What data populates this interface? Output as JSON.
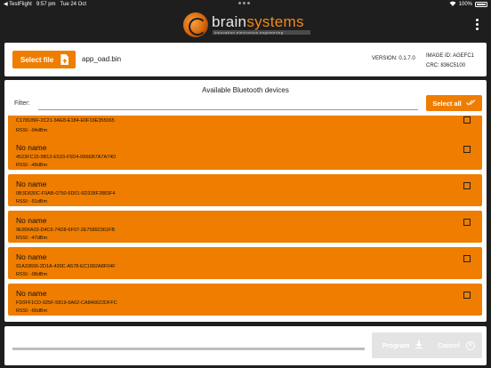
{
  "status_bar": {
    "back_app": "◀ TestFlight",
    "time": "9:57 pm",
    "date": "Tue 24 Oct",
    "battery": "100%"
  },
  "header": {
    "logo_brain": "brain",
    "logo_systems": "systems",
    "logo_tagline": "innovation electronics engineering"
  },
  "file_card": {
    "select_label": "Select file",
    "filename": "app_oad.bin",
    "version": "VERSION: 0.1.7.0",
    "image_id": "IMAGE ID:  AGEFC1",
    "crc": "CRC:  836C5100"
  },
  "devices": {
    "title": "Available Bluetooth devices",
    "filter_label": "Filter:",
    "filter_value": "",
    "select_all_label": "Select all",
    "items": [
      {
        "name": "",
        "uuid": "C178189F-2C21-3AE8-E184-E0F16E355065",
        "rssi": "RSSI: -94dBm",
        "checked": false
      },
      {
        "name": "No name",
        "uuid": "4523FC15-9B13-E533-F5D4-066EB7A7A74D",
        "rssi": "RSSI: -48dBm",
        "checked": false
      },
      {
        "name": "No name",
        "uuid": "0B3D830C-F9AB-0750-6D01-6D328F2883F4",
        "rssi": "RSSI: -51dBm",
        "checked": false
      },
      {
        "name": "No name",
        "uuid": "9E806A03-D4C6-74D8-6F07-2E75892361FB",
        "rssi": "RSSI: -47dBm",
        "checked": false
      },
      {
        "name": "No name",
        "uuid": "91A33656-2D1A-439C-A578-EC1992A8F04F",
        "rssi": "RSSI: -98dBm",
        "checked": false
      },
      {
        "name": "No name",
        "uuid": "FD0FF1CD-925F-5819-6A62-CA846622DFFC",
        "rssi": "RSSI: -66dBm",
        "checked": false
      }
    ]
  },
  "actions": {
    "progress": 0,
    "program_label": "Program",
    "cancel_label": "Cancel"
  },
  "colors": {
    "accent": "#ef7d00",
    "disabled": "#e4e4e4",
    "background": "#1e1e1e"
  }
}
